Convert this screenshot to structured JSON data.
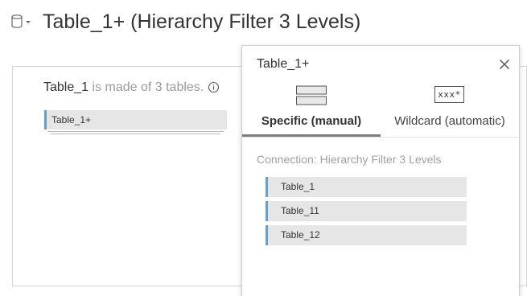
{
  "header": {
    "datasource_icon": "datasource-cylinder-icon",
    "title": "Table_1+ (Hierarchy Filter 3 Levels)"
  },
  "canvas": {
    "summary_name": "Table_1",
    "summary_rest": " is made of 3 tables.",
    "info_icon": "info-icon",
    "logical_table": "Table_1+"
  },
  "popup": {
    "title": "Table_1+",
    "close_icon": "close-icon",
    "tabs": [
      {
        "label": "Specific (manual)",
        "icon": "stacked-tables-icon",
        "selected": true
      },
      {
        "label": "Wildcard (automatic)",
        "icon": "wildcard-icon",
        "icon_text": "xxx*",
        "selected": false
      }
    ],
    "connection": "Connection: Hierarchy Filter 3 Levels",
    "tables": [
      "Table_1",
      "Table_11",
      "Table_12"
    ]
  },
  "colors": {
    "accent_bar": "#6b9ec6",
    "pill_bg": "#e6e6e6",
    "tab_underline": "#7d7d7d"
  }
}
